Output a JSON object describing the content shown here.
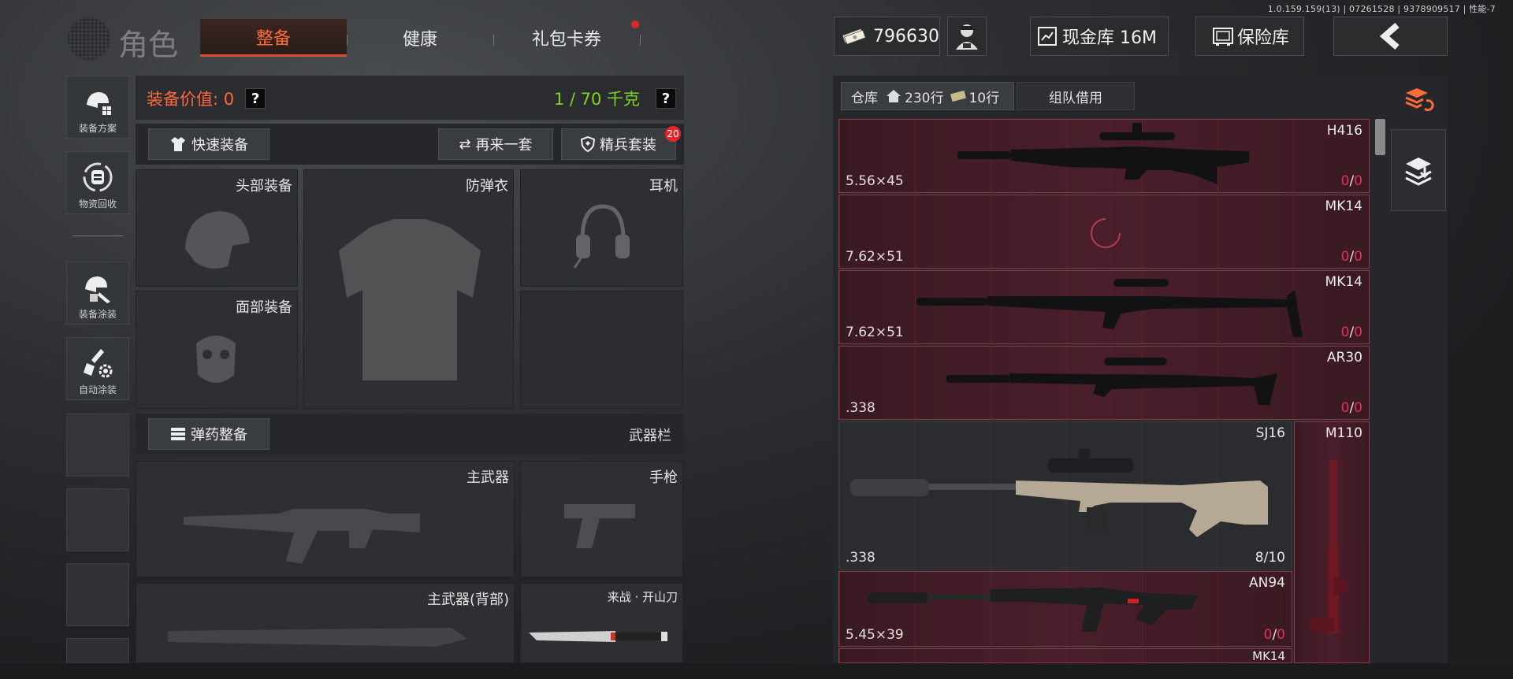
{
  "version": "1.0.159.159(13) | 07261528 | 9378909517 | 性能-7",
  "header": {
    "title": "角色",
    "tabs": [
      {
        "label": "整备",
        "active": true
      },
      {
        "label": "健康",
        "active": false
      },
      {
        "label": "礼包卡券",
        "active": false,
        "notification_dot": true
      }
    ],
    "currency": "796630",
    "cash_vault": "现金库 16M",
    "safe_vault": "保险库"
  },
  "left_menu": [
    {
      "label": "装备方案",
      "icon": "helmet-plan-icon"
    },
    {
      "label": "物资回收",
      "icon": "recycle-icon"
    },
    {
      "label": "装备涂装",
      "icon": "paint-helmet-icon"
    },
    {
      "label": "自动涂装",
      "icon": "auto-paint-icon"
    }
  ],
  "loadout": {
    "value_label": "装备价值: 0",
    "weight": "1 / 70 千克",
    "quick_equip": "快速装备",
    "repeat": "再来一套",
    "elite": "精兵套装",
    "elite_badge": "20",
    "slots": {
      "head": "头部装备",
      "face": "面部装备",
      "armor": "防弹衣",
      "headset": "耳机"
    },
    "ammo": "弹药整备",
    "weapon_bar": "武器栏",
    "weapons": {
      "primary": "主武器",
      "pistol": "手枪",
      "primary_back": "主武器(背部)",
      "melee": "来战 · 开山刀"
    }
  },
  "warehouse": {
    "tab": "仓库",
    "rows_a": "230行",
    "rows_b": "10行",
    "team_borrow": "组队借用",
    "items": [
      {
        "name": "H416",
        "caliber": "5.56×45",
        "count": "0",
        "max": "0",
        "zero": true
      },
      {
        "name": "MK14",
        "caliber": "7.62×51",
        "count": "0",
        "max": "0",
        "zero": true
      },
      {
        "name": "MK14",
        "caliber": "7.62×51",
        "count": "0",
        "max": "0",
        "zero": true
      },
      {
        "name": "AR30",
        "caliber": ".338",
        "count": "0",
        "max": "0",
        "zero": true
      },
      {
        "name": "SJ16",
        "caliber": ".338",
        "count": "8",
        "max": "10",
        "zero": false
      },
      {
        "name": "M110",
        "caliber": "",
        "count": "",
        "max": "",
        "zero": true
      },
      {
        "name": "AN94",
        "caliber": "5.45×39",
        "count": "0",
        "max": "0",
        "zero": true
      },
      {
        "name": "MK14",
        "caliber": "",
        "count": "",
        "max": "",
        "zero": true
      }
    ]
  },
  "colors": {
    "accent": "#ff6a3a",
    "zero_count": "#e0325a",
    "weight_ok": "#7ed321",
    "item_bg": "#4a1e2a"
  }
}
